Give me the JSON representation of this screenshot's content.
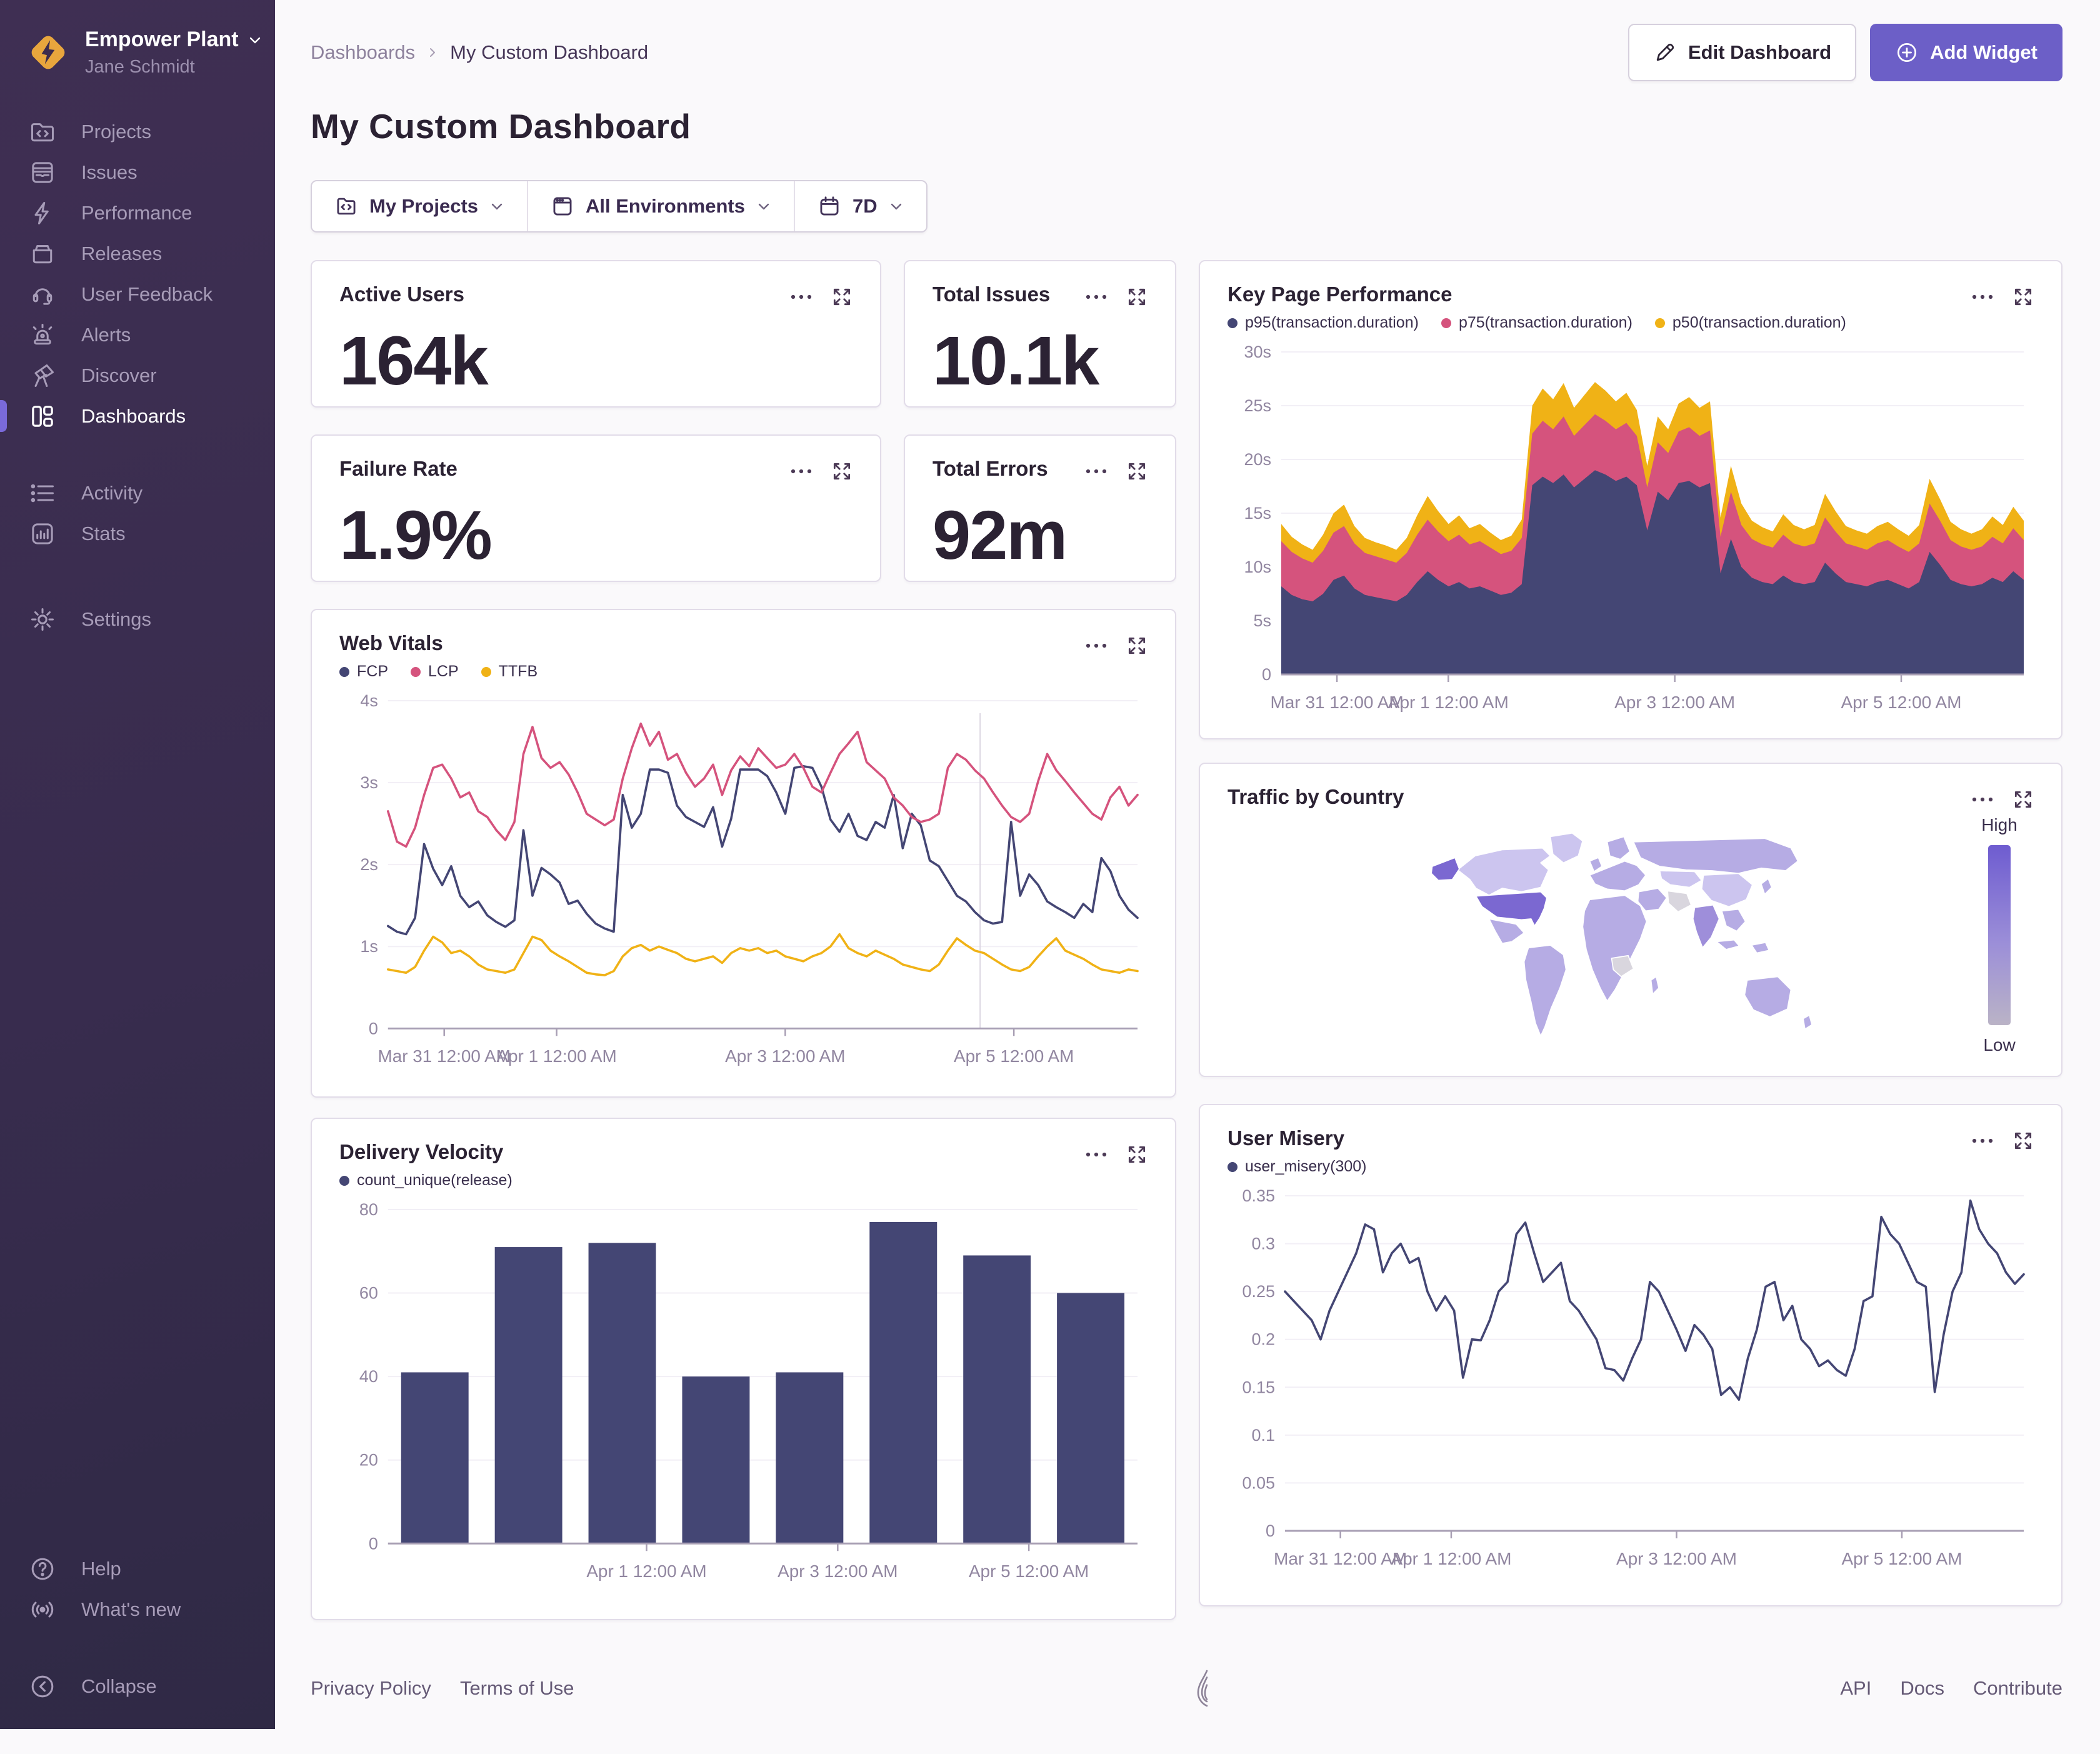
{
  "colors": {
    "accent": "#6c5fc7",
    "active_indicator": "#7a6ada",
    "chart_navy": "#444674",
    "chart_pink": "#d5537d",
    "chart_yellow": "#f0b216"
  },
  "sidebar": {
    "org_name": "Empower Plant",
    "user_name": "Jane Schmidt",
    "items": [
      {
        "label": "Projects"
      },
      {
        "label": "Issues"
      },
      {
        "label": "Performance"
      },
      {
        "label": "Releases"
      },
      {
        "label": "User Feedback"
      },
      {
        "label": "Alerts"
      },
      {
        "label": "Discover"
      },
      {
        "label": "Dashboards"
      },
      {
        "label": "Activity"
      },
      {
        "label": "Stats"
      },
      {
        "label": "Settings"
      }
    ],
    "footer_items": [
      {
        "label": "Help"
      },
      {
        "label": "What's new"
      },
      {
        "label": "Collapse"
      }
    ]
  },
  "header": {
    "breadcrumb_root": "Dashboards",
    "breadcrumb_current": "My Custom Dashboard",
    "title": "My Custom Dashboard",
    "edit_button": "Edit Dashboard",
    "add_button": "Add Widget"
  },
  "filters": {
    "projects": "My Projects",
    "environments": "All Environments",
    "period": "7D"
  },
  "widgets": {
    "active_users": {
      "title": "Active Users",
      "value": "164k"
    },
    "total_issues": {
      "title": "Total Issues",
      "value": "10.1k"
    },
    "failure_rate": {
      "title": "Failure Rate",
      "value": "1.9%"
    },
    "total_errors": {
      "title": "Total Errors",
      "value": "92m"
    },
    "web_vitals": {
      "title": "Web Vitals"
    },
    "key_page": {
      "title": "Key Page Performance"
    },
    "traffic": {
      "title": "Traffic by Country"
    },
    "delivery": {
      "title": "Delivery Velocity"
    },
    "user_misery": {
      "title": "User Misery"
    }
  },
  "footer": {
    "privacy": "Privacy Policy",
    "terms": "Terms of Use",
    "api": "API",
    "docs": "Docs",
    "contribute": "Contribute"
  },
  "chart_data": {
    "web_vitals": {
      "type": "line",
      "title": "Web Vitals",
      "ylim": [
        0,
        4
      ],
      "yticks": [
        {
          "v": 4,
          "label": "4s"
        },
        {
          "v": 3,
          "label": "3s"
        },
        {
          "v": 2,
          "label": "2s"
        },
        {
          "v": 1,
          "label": "1s"
        },
        {
          "v": 0,
          "label": "0"
        }
      ],
      "xticks": [
        {
          "pos": 0.075,
          "label": "Mar 31 12:00 AM"
        },
        {
          "pos": 0.225,
          "label": "Apr 1 12:00 AM"
        },
        {
          "pos": 0.53,
          "label": "Apr 3 12:00 AM"
        },
        {
          "pos": 0.835,
          "label": "Apr 5 12:00 AM"
        }
      ],
      "cursor": 0.79,
      "margin_left": 78,
      "series": [
        {
          "name": "FCP",
          "color": "#444674",
          "values": [
            1.25,
            1.18,
            1.15,
            1.35,
            2.25,
            1.95,
            1.75,
            1.98,
            1.62,
            1.48,
            1.55,
            1.38,
            1.3,
            1.24,
            1.32,
            2.42,
            1.62,
            1.96,
            1.88,
            1.78,
            1.52,
            1.56,
            1.4,
            1.28,
            1.22,
            1.18,
            2.85,
            2.45,
            2.62,
            3.16,
            3.16,
            3.12,
            2.72,
            2.58,
            2.52,
            2.46,
            2.7,
            2.22,
            2.56,
            3.16,
            3.16,
            3.16,
            3.08,
            2.88,
            2.62,
            3.18,
            3.2,
            3.18,
            2.95,
            2.55,
            2.4,
            2.62,
            2.35,
            2.3,
            2.52,
            2.45,
            2.85,
            2.2,
            2.62,
            2.48,
            2.05,
            1.98,
            1.8,
            1.62,
            1.55,
            1.42,
            1.32,
            1.28,
            1.3,
            2.52,
            1.62,
            1.88,
            1.75,
            1.55,
            1.48,
            1.42,
            1.35,
            1.52,
            1.42,
            2.08,
            1.92,
            1.62,
            1.45,
            1.35
          ]
        },
        {
          "name": "LCP",
          "color": "#d5537d",
          "values": [
            2.65,
            2.28,
            2.22,
            2.45,
            2.85,
            3.18,
            3.22,
            3.05,
            2.82,
            2.88,
            2.65,
            2.58,
            2.42,
            2.3,
            2.52,
            3.35,
            3.68,
            3.3,
            3.18,
            3.25,
            3.1,
            2.88,
            2.62,
            2.55,
            2.48,
            2.55,
            3.05,
            3.42,
            3.72,
            3.45,
            3.62,
            3.28,
            3.35,
            3.12,
            2.95,
            3.05,
            3.22,
            2.85,
            3.15,
            3.32,
            3.2,
            3.42,
            3.3,
            3.18,
            3.22,
            3.35,
            3.18,
            2.95,
            2.88,
            3.12,
            3.35,
            3.48,
            3.62,
            3.25,
            3.15,
            3.05,
            2.82,
            2.72,
            2.58,
            2.52,
            2.55,
            2.62,
            3.18,
            3.35,
            3.28,
            3.15,
            3.05,
            2.88,
            2.72,
            2.58,
            2.52,
            2.62,
            3.02,
            3.35,
            3.15,
            3.02,
            2.88,
            2.75,
            2.62,
            2.55,
            2.82,
            2.95,
            2.72,
            2.85
          ]
        },
        {
          "name": "TTFB",
          "color": "#f0b216",
          "values": [
            0.72,
            0.7,
            0.68,
            0.75,
            0.95,
            1.12,
            1.05,
            0.92,
            0.95,
            0.88,
            0.78,
            0.72,
            0.7,
            0.68,
            0.72,
            0.92,
            1.12,
            1.08,
            0.95,
            0.88,
            0.82,
            0.75,
            0.68,
            0.66,
            0.65,
            0.7,
            0.88,
            0.98,
            1.02,
            0.95,
            1.0,
            0.96,
            0.92,
            0.85,
            0.82,
            0.85,
            0.88,
            0.8,
            0.92,
            0.98,
            0.95,
            0.98,
            0.92,
            0.95,
            0.88,
            0.85,
            0.82,
            0.88,
            0.92,
            1.0,
            1.15,
            0.98,
            0.92,
            0.88,
            0.95,
            0.9,
            0.85,
            0.78,
            0.75,
            0.72,
            0.7,
            0.78,
            0.95,
            1.1,
            1.02,
            0.95,
            0.92,
            0.85,
            0.78,
            0.72,
            0.7,
            0.75,
            0.88,
            1.0,
            1.1,
            0.95,
            0.9,
            0.85,
            0.78,
            0.72,
            0.7,
            0.68,
            0.72,
            0.7
          ]
        }
      ]
    },
    "key_page_performance": {
      "type": "stacked_area",
      "title": "Key Page Performance",
      "ylim": [
        0,
        30
      ],
      "yticks": [
        {
          "v": 30,
          "label": "30s"
        },
        {
          "v": 25,
          "label": "25s"
        },
        {
          "v": 20,
          "label": "20s"
        },
        {
          "v": 15,
          "label": "15s"
        },
        {
          "v": 10,
          "label": "10s"
        },
        {
          "v": 5,
          "label": "5s"
        },
        {
          "v": 0,
          "label": "0"
        }
      ],
      "xticks": [
        {
          "pos": 0.075,
          "label": "Mar 31 12:00 AM"
        },
        {
          "pos": 0.225,
          "label": "Apr 1 12:00 AM"
        },
        {
          "pos": 0.53,
          "label": "Apr 3 12:00 AM"
        },
        {
          "pos": 0.835,
          "label": "Apr 5 12:00 AM"
        }
      ],
      "margin_left": 86,
      "series": [
        {
          "name": "p95(transaction.duration)",
          "color": "#444674",
          "values": [
            8.2,
            7.4,
            7.0,
            6.8,
            7.5,
            8.8,
            9.2,
            8.0,
            7.4,
            7.2,
            7.0,
            6.8,
            7.4,
            8.6,
            9.6,
            8.8,
            8.2,
            8.6,
            8.0,
            8.2,
            7.8,
            7.4,
            7.6,
            8.4,
            17.6,
            18.4,
            17.8,
            18.6,
            17.4,
            18.2,
            19.0,
            18.6,
            18.0,
            18.4,
            17.6,
            13.4,
            17.0,
            16.2,
            17.8,
            18.0,
            17.4,
            17.8,
            9.4,
            12.6,
            10.0,
            9.0,
            8.6,
            8.4,
            9.2,
            8.6,
            8.4,
            8.6,
            10.4,
            9.4,
            8.6,
            8.4,
            8.2,
            8.6,
            8.8,
            8.4,
            8.0,
            8.6,
            11.4,
            10.2,
            8.8,
            8.4,
            8.2,
            8.4,
            9.0,
            8.6,
            9.6,
            8.8
          ]
        },
        {
          "name": "p75(transaction.duration)",
          "color": "#d5537d",
          "values": [
            4.2,
            4.0,
            3.8,
            3.6,
            4.0,
            4.4,
            4.6,
            4.2,
            3.9,
            3.8,
            3.7,
            3.6,
            3.9,
            4.4,
            4.8,
            4.5,
            4.2,
            4.4,
            4.1,
            4.2,
            4.0,
            3.8,
            3.9,
            4.3,
            4.8,
            5.2,
            5.0,
            5.4,
            4.8,
            5.0,
            5.2,
            5.0,
            4.8,
            5.0,
            4.6,
            4.0,
            4.6,
            4.4,
            4.8,
            5.0,
            4.8,
            4.9,
            3.4,
            4.4,
            3.9,
            3.6,
            3.5,
            3.4,
            3.8,
            3.6,
            3.5,
            3.6,
            4.2,
            3.9,
            3.6,
            3.5,
            3.4,
            3.6,
            3.7,
            3.5,
            3.4,
            3.6,
            4.5,
            4.1,
            3.7,
            3.5,
            3.4,
            3.5,
            3.8,
            3.6,
            4.0,
            3.7
          ]
        },
        {
          "name": "p50(transaction.duration)",
          "color": "#f0b216",
          "values": [
            1.6,
            1.4,
            1.3,
            1.2,
            1.5,
            1.8,
            2.0,
            1.6,
            1.4,
            1.3,
            1.3,
            1.2,
            1.4,
            1.8,
            2.2,
            1.9,
            1.6,
            1.8,
            1.5,
            1.6,
            1.4,
            1.3,
            1.4,
            1.7,
            2.6,
            3.0,
            2.8,
            3.1,
            2.6,
            2.8,
            3.0,
            2.8,
            2.6,
            2.8,
            2.4,
            2.0,
            2.4,
            2.2,
            2.6,
            2.8,
            2.6,
            2.7,
            1.8,
            2.4,
            2.0,
            1.7,
            1.6,
            1.5,
            1.9,
            1.7,
            1.6,
            1.7,
            2.2,
            1.9,
            1.6,
            1.5,
            1.5,
            1.6,
            1.7,
            1.6,
            1.5,
            1.7,
            2.3,
            2.0,
            1.7,
            1.6,
            1.5,
            1.6,
            1.9,
            1.7,
            2.0,
            1.8
          ]
        }
      ]
    },
    "delivery_velocity": {
      "type": "bar",
      "title": "Delivery Velocity",
      "series_name": "count_unique(release)",
      "color": "#444674",
      "ylim": [
        0,
        80
      ],
      "yticks": [
        {
          "v": 80,
          "label": "80"
        },
        {
          "v": 60,
          "label": "60"
        },
        {
          "v": 40,
          "label": "40"
        },
        {
          "v": 20,
          "label": "20"
        },
        {
          "v": 0,
          "label": "0"
        }
      ],
      "xticks": [
        {
          "pos": 0.345,
          "label": "Apr 1 12:00 AM"
        },
        {
          "pos": 0.6,
          "label": "Apr 3 12:00 AM"
        },
        {
          "pos": 0.855,
          "label": "Apr 5 12:00 AM"
        }
      ],
      "margin_left": 78,
      "values": [
        41,
        71,
        72,
        40,
        41,
        77,
        69,
        60
      ]
    },
    "user_misery": {
      "type": "line",
      "title": "User Misery",
      "series_name": "user_misery(300)",
      "ylim": [
        0,
        0.35
      ],
      "yticks": [
        {
          "v": 0.35,
          "label": "0.35"
        },
        {
          "v": 0.3,
          "label": "0.3"
        },
        {
          "v": 0.25,
          "label": "0.25"
        },
        {
          "v": 0.2,
          "label": "0.2"
        },
        {
          "v": 0.15,
          "label": "0.15"
        },
        {
          "v": 0.1,
          "label": "0.1"
        },
        {
          "v": 0.05,
          "label": "0.05"
        },
        {
          "v": 0,
          "label": "0"
        }
      ],
      "xticks": [
        {
          "pos": 0.075,
          "label": "Mar 31 12:00 AM"
        },
        {
          "pos": 0.225,
          "label": "Apr 1 12:00 AM"
        },
        {
          "pos": 0.53,
          "label": "Apr 3 12:00 AM"
        },
        {
          "pos": 0.835,
          "label": "Apr 5 12:00 AM"
        }
      ],
      "margin_left": 92,
      "series": [
        {
          "name": "user_misery(300)",
          "color": "#444674",
          "values": [
            0.25,
            0.24,
            0.23,
            0.22,
            0.2,
            0.23,
            0.25,
            0.27,
            0.29,
            0.32,
            0.315,
            0.27,
            0.29,
            0.3,
            0.28,
            0.285,
            0.25,
            0.23,
            0.245,
            0.23,
            0.16,
            0.2,
            0.199,
            0.22,
            0.25,
            0.26,
            0.31,
            0.322,
            0.29,
            0.26,
            0.27,
            0.28,
            0.24,
            0.23,
            0.215,
            0.2,
            0.17,
            0.168,
            0.157,
            0.18,
            0.2,
            0.26,
            0.25,
            0.23,
            0.21,
            0.188,
            0.215,
            0.205,
            0.19,
            0.142,
            0.15,
            0.137,
            0.18,
            0.21,
            0.255,
            0.26,
            0.22,
            0.235,
            0.2,
            0.19,
            0.172,
            0.178,
            0.168,
            0.162,
            0.19,
            0.24,
            0.245,
            0.328,
            0.31,
            0.3,
            0.28,
            0.26,
            0.255,
            0.145,
            0.205,
            0.25,
            0.27,
            0.345,
            0.315,
            0.3,
            0.29,
            0.27,
            0.258,
            0.268
          ]
        }
      ]
    },
    "traffic_map": {
      "type": "choropleth",
      "title": "Traffic by Country",
      "palette": {
        "high": "#7b68d1",
        "midhigh": "#9e8eda",
        "medium": "#b6ace4",
        "light": "#ccc5ef",
        "none": "#d9d6de"
      },
      "legend": {
        "high_label": "High",
        "low_label": "Low",
        "gradient": [
          "#6e5cd0",
          "#9c8fd8",
          "#bab3c6"
        ]
      },
      "regions": {
        "united-states": "high",
        "alaska": "high",
        "canada": "light",
        "greenland": "light",
        "china": "light",
        "kazakhstan": "light",
        "india": "midhigh",
        "iran": "none",
        "dr-congo": "none"
      },
      "default_level": "medium"
    }
  }
}
